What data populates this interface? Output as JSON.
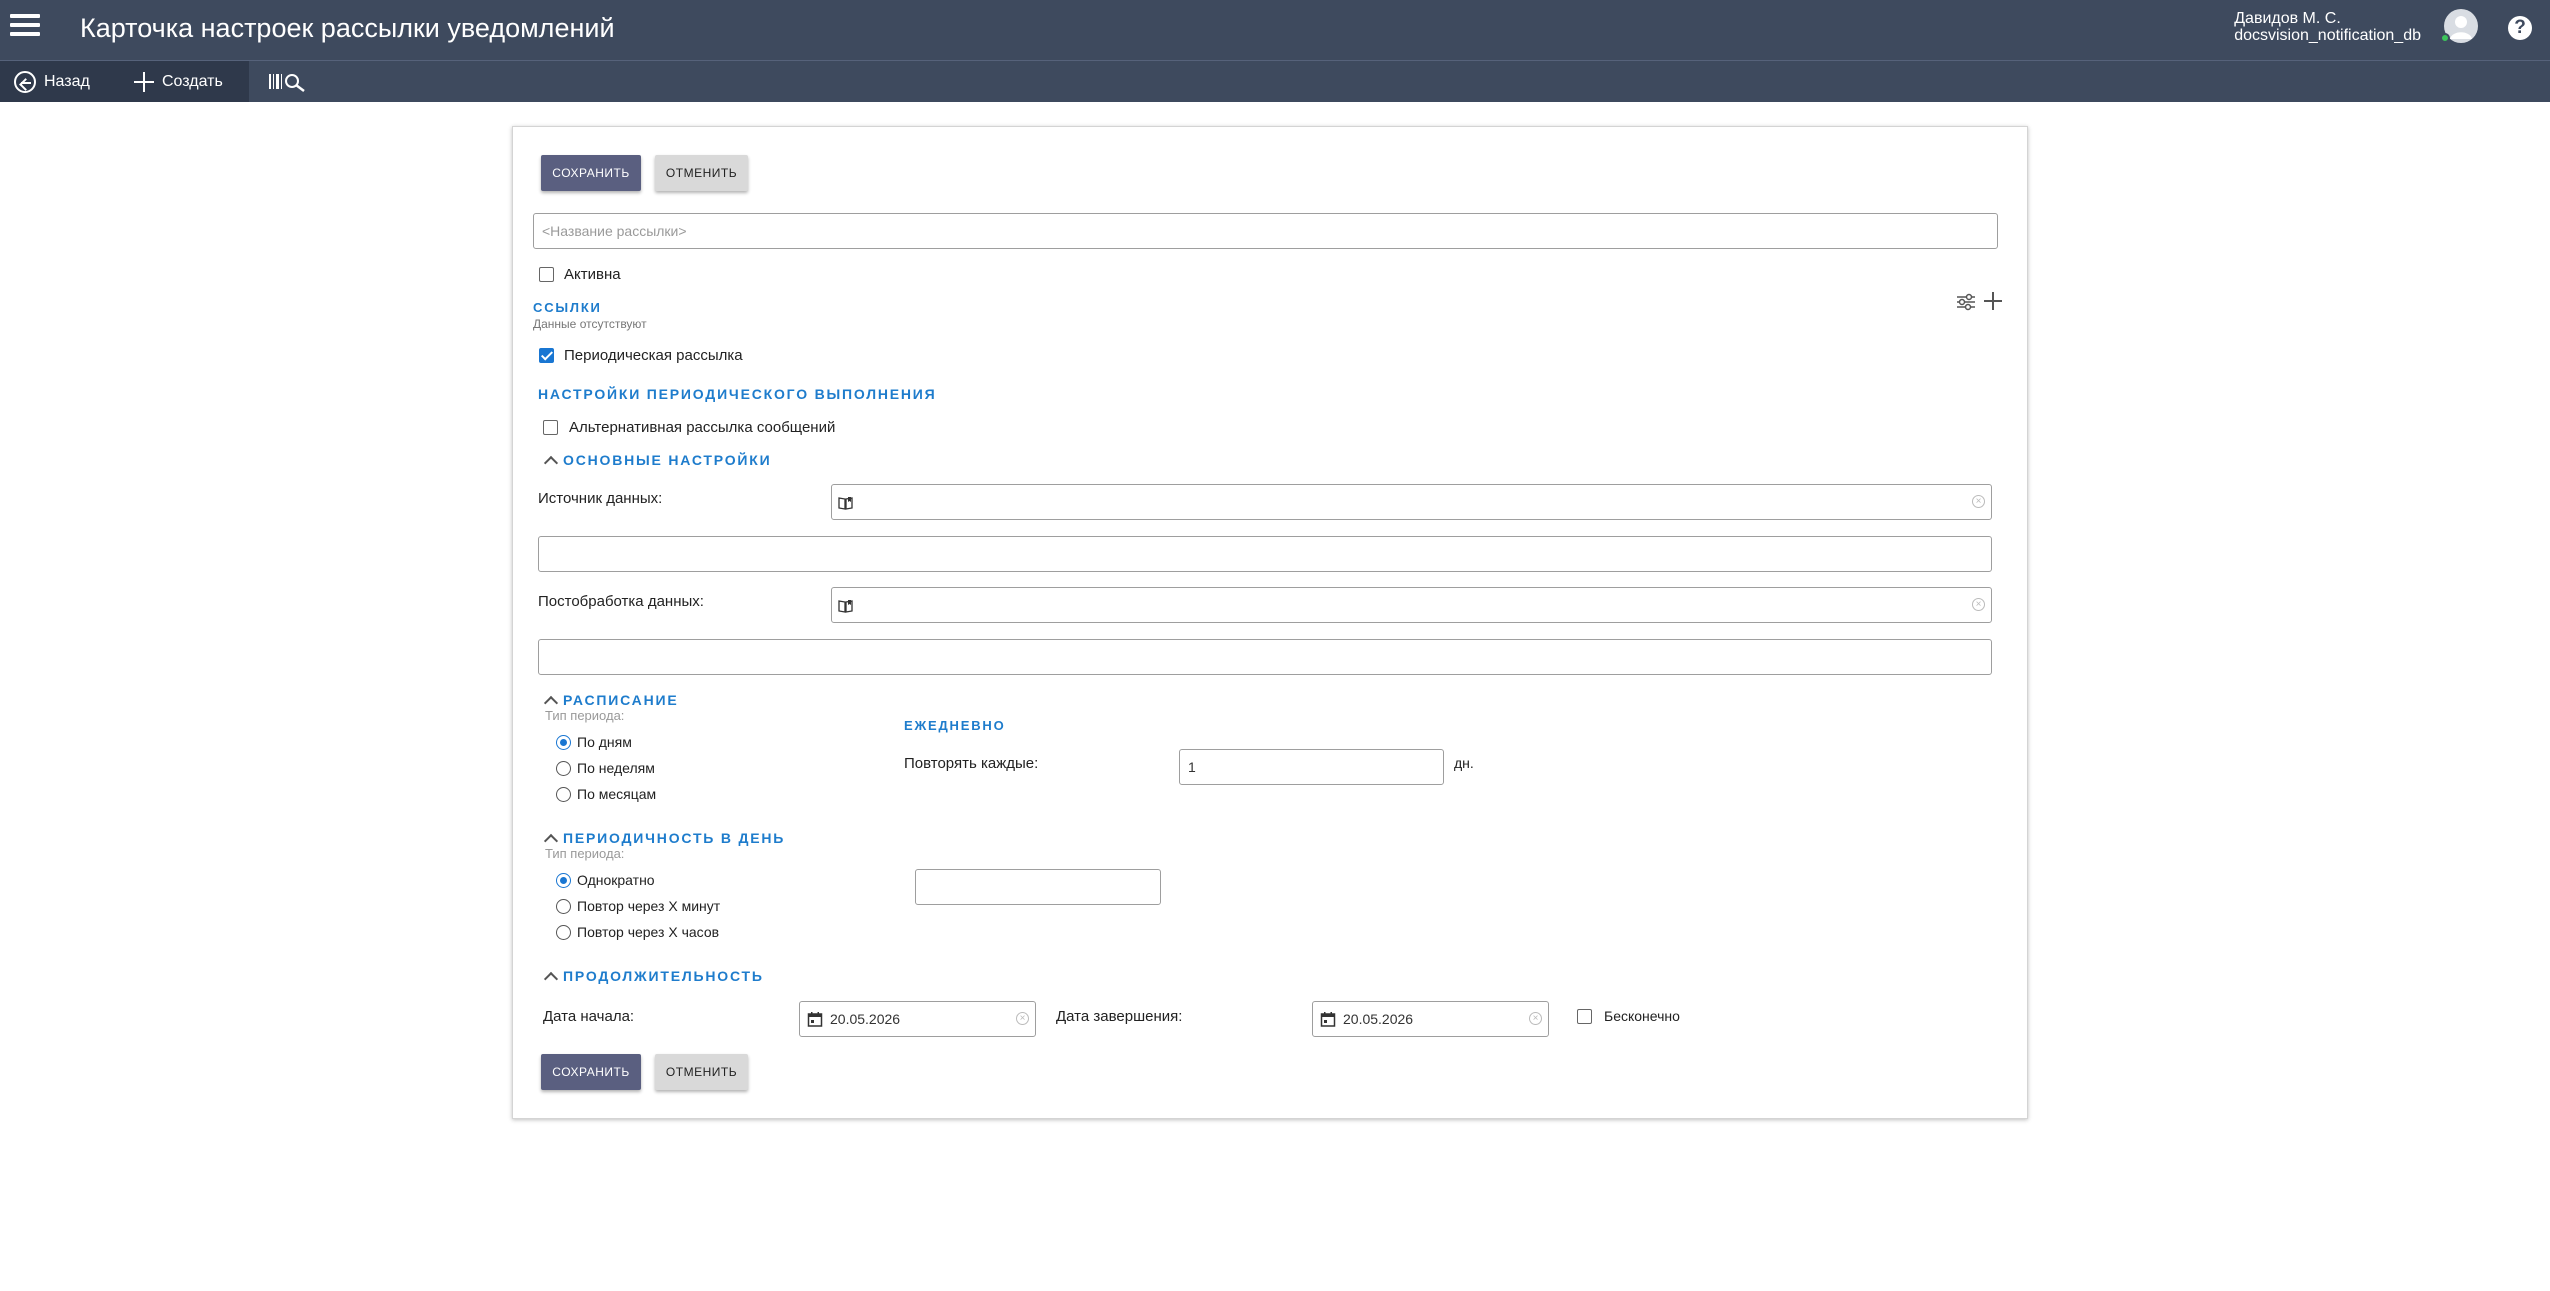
{
  "header": {
    "title": "Карточка настроек рассылки уведомлений",
    "user_name": "Давидов М. С.",
    "database": "docsvision_notification_db",
    "help": "?"
  },
  "toolbar": {
    "back_label": "Назад",
    "create_label": "Создать"
  },
  "form": {
    "save_label": "СОХРАНИТЬ",
    "cancel_label": "ОТМЕНИТЬ",
    "name_placeholder": "<Название рассылки>",
    "name_value": "",
    "active_label": "Активна",
    "active_checked": false,
    "links_title": "ССЫЛКИ",
    "links_empty": "Данные отсутствуют",
    "periodic_label": "Периодическая рассылка",
    "periodic_checked": true,
    "periodic_settings_title": "НАСТРОЙКИ ПЕРИОДИЧЕСКОГО ВЫПОЛНЕНИЯ",
    "alt_label": "Альтернативная рассылка сообщений",
    "alt_checked": false,
    "main_settings_title": "ОСНОВНЫЕ НАСТРОЙКИ",
    "data_source_label": "Источник данных:",
    "data_source_value": "",
    "data_source_extra": "",
    "postprocess_label": "Постобработка данных:",
    "postprocess_value": "",
    "postprocess_extra": ""
  },
  "schedule": {
    "title": "РАСПИСАНИЕ",
    "period_type_label": "Тип периода:",
    "options": [
      "По дням",
      "По неделям",
      "По месяцам"
    ],
    "selected_index": 0,
    "daily_title": "ЕЖЕДНЕВНО",
    "repeat_label": "Повторять каждые:",
    "repeat_value": "1",
    "repeat_unit": "дн."
  },
  "daily_frequency": {
    "title": "ПЕРИОДИЧНОСТЬ В ДЕНЬ",
    "period_type_label": "Тип периода:",
    "options": [
      "Однократно",
      "Повтор через Х минут",
      "Повтор через Х часов"
    ],
    "selected_index": 0,
    "time_value": ""
  },
  "duration": {
    "title": "ПРОДОЛЖИТЕЛЬНОСТЬ",
    "start_label": "Дата начала:",
    "start_value": "20.05.2026",
    "end_label": "Дата завершения:",
    "end_value": "20.05.2026",
    "infinite_label": "Бесконечно",
    "infinite_checked": false
  },
  "colors": {
    "header_bg": "#3e4a5e",
    "accent": "#1e7ccc",
    "primary_button": "#5a5f80"
  }
}
